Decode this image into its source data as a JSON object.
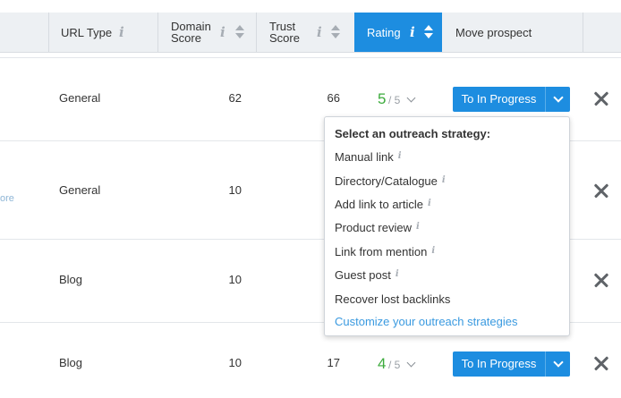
{
  "header": {
    "url_type": "URL Type",
    "domain_score": [
      "Domain",
      "Score"
    ],
    "trust_score": [
      "Trust",
      "Score"
    ],
    "rating": "Rating",
    "move_prospect": "Move prospect",
    "info_glyph": "i"
  },
  "rows": [
    {
      "url_type": "General",
      "domain_score": "62",
      "trust_score": "66",
      "rating": "5",
      "rating_max": "/ 5",
      "button": "To In Progress"
    },
    {
      "url_type": "General",
      "domain_score": "10",
      "partial_left": "ore"
    },
    {
      "url_type": "Blog",
      "domain_score": "10"
    },
    {
      "url_type": "Blog",
      "domain_score": "10",
      "trust_score": "17",
      "rating": "4",
      "rating_max": "/ 5",
      "button": "To In Progress"
    }
  ],
  "dropdown": {
    "title": "Select an outreach strategy:",
    "items": [
      "Manual link",
      "Directory/Catalogue",
      "Add link to article",
      "Product review",
      "Link from mention",
      "Guest post",
      "Recover lost backlinks"
    ],
    "info_glyph": "i",
    "link": "Customize your outreach strategies"
  },
  "colors": {
    "accent": "#1d8de0",
    "rating_green": "#3cab3c",
    "link_blue": "#3a9ae0",
    "header_bg": "#edf0f3"
  },
  "icons": [
    "info-icon",
    "sort-icon",
    "chevron-down-icon",
    "close-icon"
  ]
}
